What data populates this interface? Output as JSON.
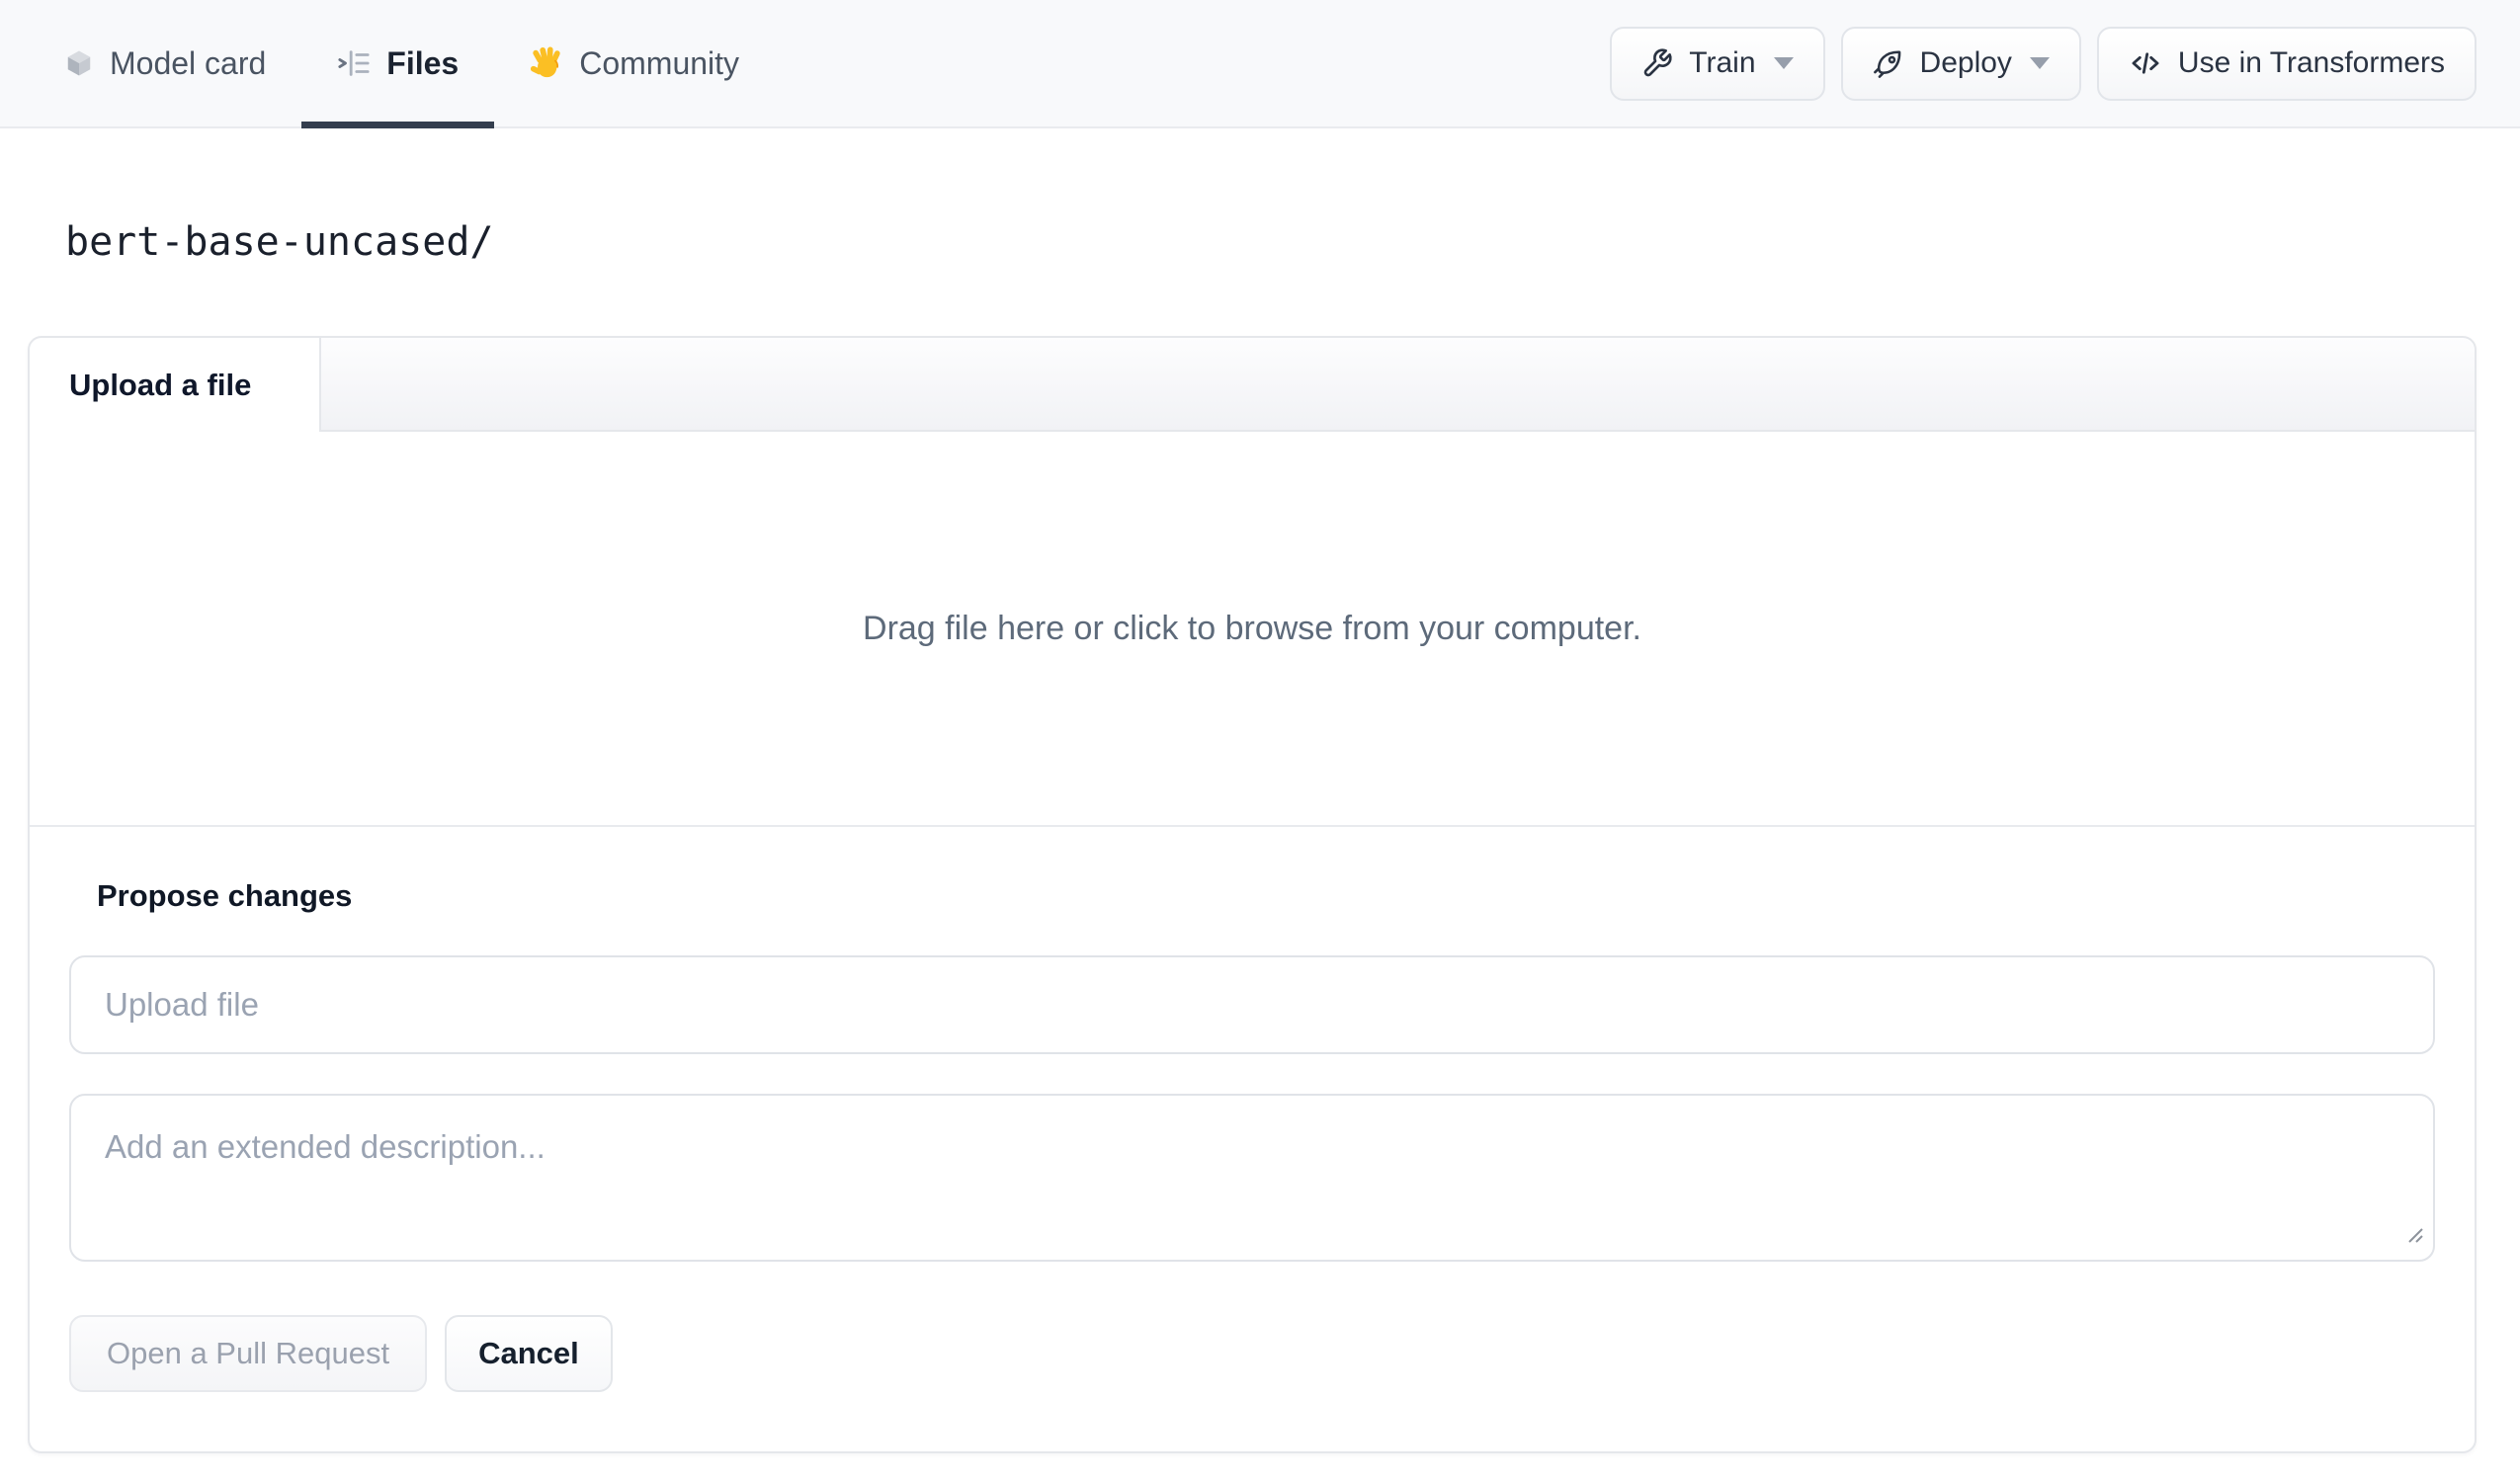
{
  "header": {
    "tabs": [
      {
        "label": "Model card",
        "icon": "cube-icon",
        "active": false
      },
      {
        "label": "Files",
        "icon": "list-tree-icon",
        "active": true
      },
      {
        "label": "Community",
        "icon": "waving-hand-icon",
        "active": false
      }
    ],
    "actions": [
      {
        "label": "Train",
        "icon": "wrench-icon",
        "dropdown": true
      },
      {
        "label": "Deploy",
        "icon": "rocket-icon",
        "dropdown": true
      },
      {
        "label": "Use in Transformers",
        "icon": "code-icon",
        "dropdown": false
      }
    ]
  },
  "breadcrumb": {
    "path": "bert-base-uncased/"
  },
  "upload_panel": {
    "tab_label": "Upload a file",
    "dropzone_text": "Drag file here or click to browse from your computer."
  },
  "propose": {
    "heading": "Propose changes",
    "filename_placeholder": "Upload file",
    "description_placeholder": "Add an extended description...",
    "submit_label": "Open a Pull Request",
    "cancel_label": "Cancel"
  },
  "colors": {
    "header_bg": "#f8f9fb",
    "active_underline": "#343e4e",
    "card_border": "#e5e7eb",
    "muted_text": "#5d6a7a",
    "placeholder_text": "#9aa3b2",
    "hand_emoji_yellow": "#fbbf24"
  }
}
